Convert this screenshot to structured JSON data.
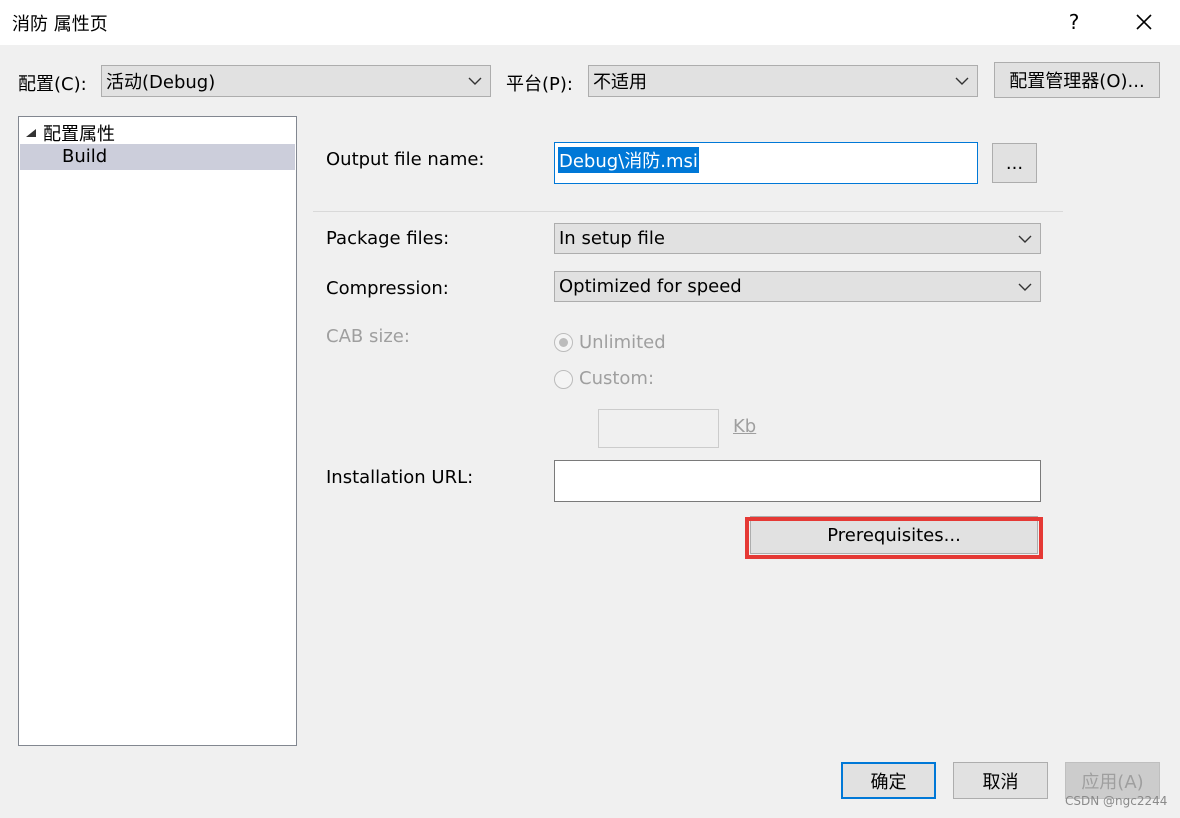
{
  "window": {
    "title": "消防 属性页",
    "help_label": "?"
  },
  "toolbar": {
    "config_label": "配置(C):",
    "config_value": "活动(Debug)",
    "platform_label": "平台(P):",
    "platform_value": "不适用",
    "config_manager_label": "配置管理器(O)..."
  },
  "tree": {
    "root_label": "配置属性",
    "selected_item": "Build"
  },
  "form": {
    "output_file_label": "Output file name:",
    "output_file_value": "Debug\\消防.msi",
    "browse_label": "...",
    "package_files_label": "Package files:",
    "package_files_value": "In setup file",
    "compression_label": "Compression:",
    "compression_value": "Optimized for speed",
    "cab_size_label": "CAB size:",
    "unlimited_label": "Unlimited",
    "custom_label": "Custom:",
    "kb_label": "Kb",
    "installation_url_label": "Installation URL:",
    "installation_url_value": "",
    "prerequisites_label": "Prerequisites..."
  },
  "footer": {
    "ok_label": "确定",
    "cancel_label": "取消",
    "apply_label": "应用(A)"
  },
  "watermark": "CSDN @ngc2244",
  "colors": {
    "highlight": "#0078d7",
    "annotation_box": "#e53935",
    "tree_selection": "#cccedb",
    "disabled_text": "#9f9f9f"
  }
}
